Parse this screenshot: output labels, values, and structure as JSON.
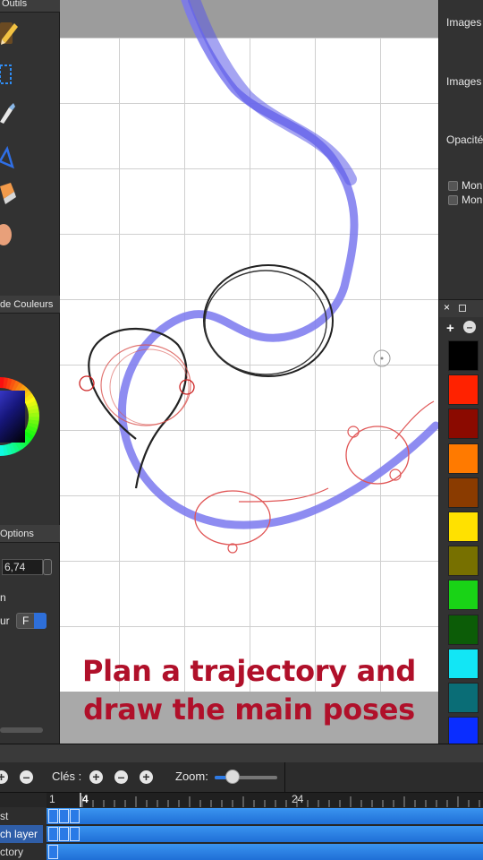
{
  "left_panel": {
    "tools_header": "Outils",
    "colors_header": "de Couleurs",
    "options_header": "Options",
    "size_value": "6,74",
    "row2_label": "n",
    "row3_label": "ur",
    "select_value": "F"
  },
  "canvas": {
    "caption_line1": "Plan a trajectory and",
    "caption_line2": "draw the main poses"
  },
  "right_panel": {
    "label1": "Images",
    "label2": "Images",
    "label3": "Opacité",
    "check1": "Mon",
    "check2": "Mon",
    "palette_close": "×",
    "palette_add": "+",
    "palette_colors": [
      "#000000",
      "#ff2200",
      "#8b0a00",
      "#ff7a00",
      "#8a3b00",
      "#ffe100",
      "#777000",
      "#19d316",
      "#0c5c07",
      "#12e6f5",
      "#0a6d76",
      "#0a2dff"
    ]
  },
  "timeline": {
    "keys_label": "Clés :",
    "zoom_label": "Zoom:",
    "zoom_level": 0.28,
    "ruler_labels": [
      "1",
      "4",
      "24"
    ],
    "layers": [
      "st",
      "ch layer",
      "ctory"
    ],
    "selected_layer": 1
  }
}
